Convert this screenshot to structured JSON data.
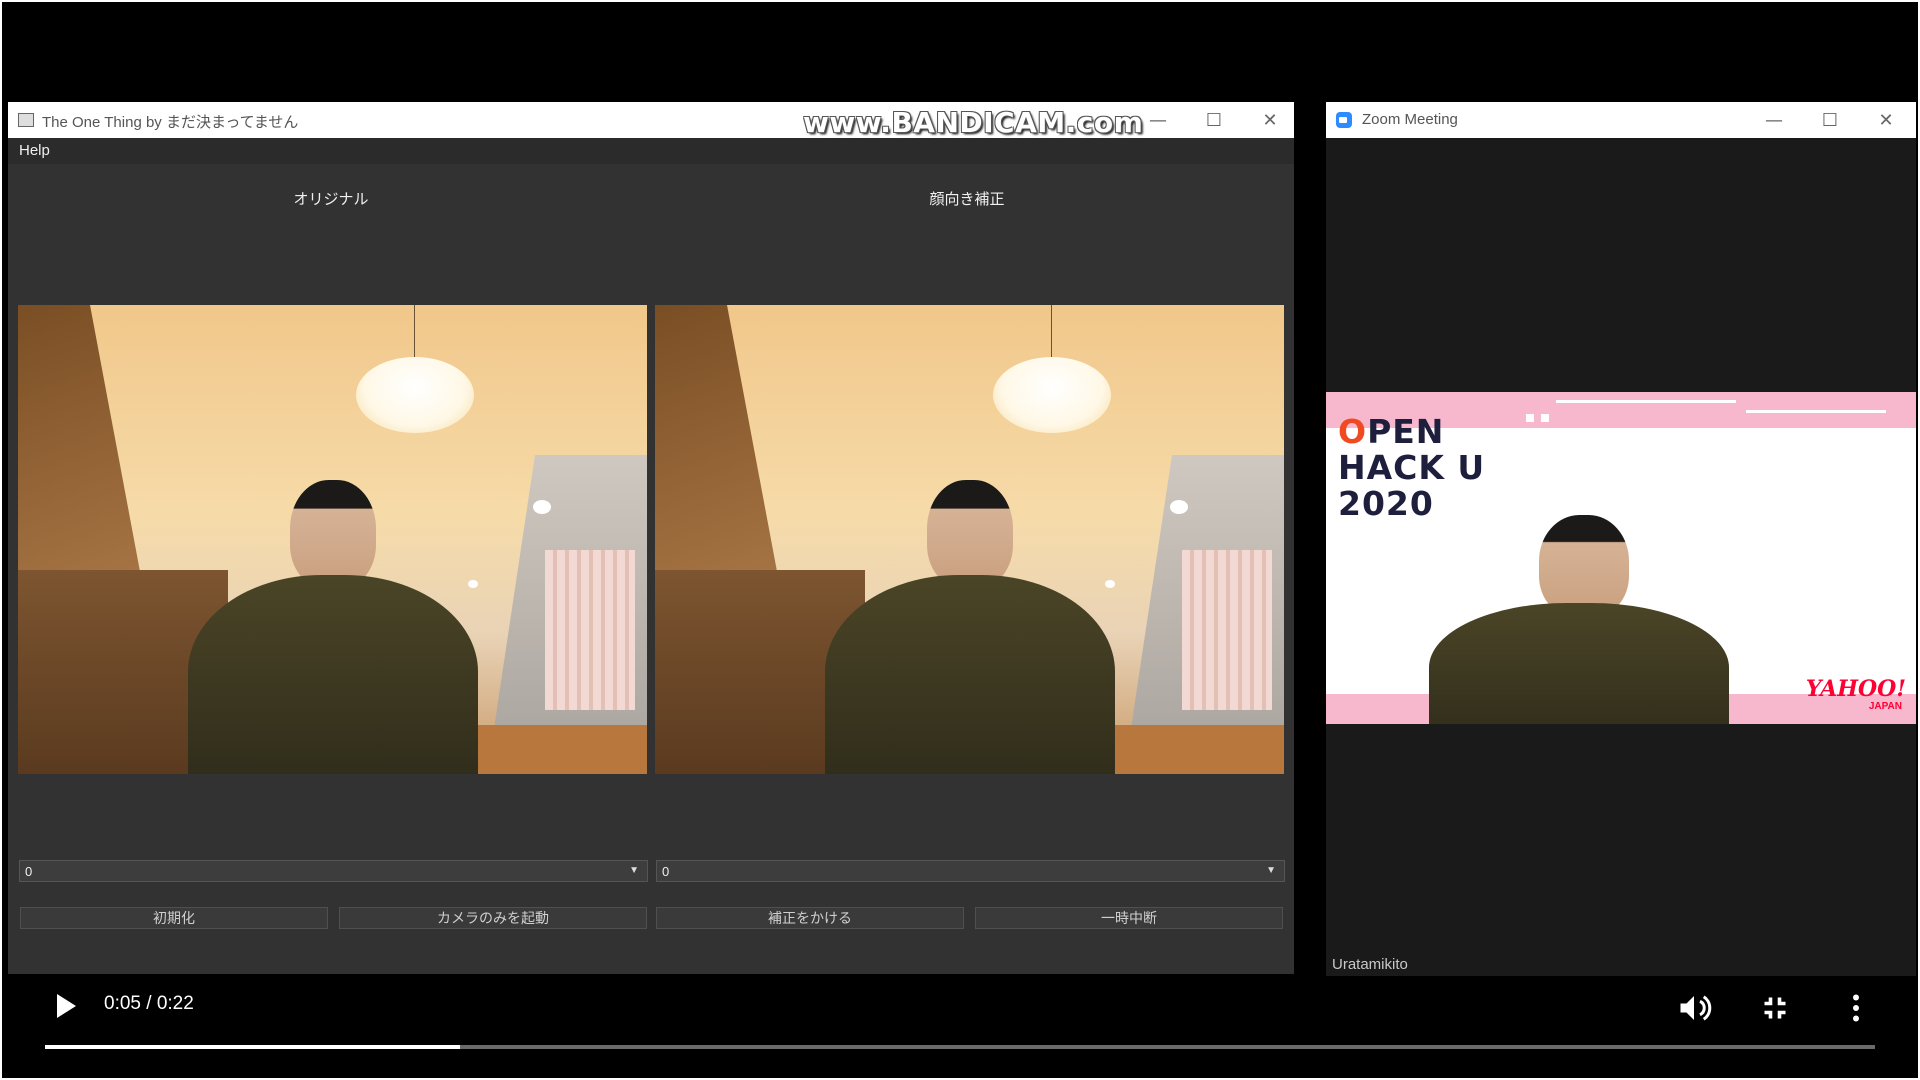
{
  "app_window": {
    "title": "The One Thing by まだ決まってません",
    "watermark": "www.BANDICAM.com",
    "menu": [
      "Help"
    ],
    "left_panel_label": "オリジナル",
    "right_panel_label": "顔向き補正",
    "left_dropdown_value": "0",
    "right_dropdown_value": "0",
    "buttons": [
      "初期化",
      "カメラのみを起動",
      "補正をかける",
      "一時中断"
    ]
  },
  "zoom_window": {
    "title": "Zoom Meeting",
    "participant_name": "Uratamikito",
    "banner": {
      "line1_prefix": "O",
      "line1_rest": "PEN",
      "line2": "HACK U",
      "line3": "2020",
      "sponsor": "YAHOO!",
      "sponsor_sub": "JAPAN"
    }
  },
  "player": {
    "time_display": "0:05 / 0:22",
    "progress_fraction": 0.227
  },
  "colors": {
    "accent_zoom": "#2d8cff",
    "open_hack_orange": "#f04a23",
    "banner_pink": "#f7b7cc",
    "yahoo_red": "#ff0033"
  },
  "icons": {
    "play": "play-icon",
    "volume": "volume-icon",
    "exit_fullscreen": "exit-fullscreen-icon",
    "more": "more-vertical-icon"
  }
}
